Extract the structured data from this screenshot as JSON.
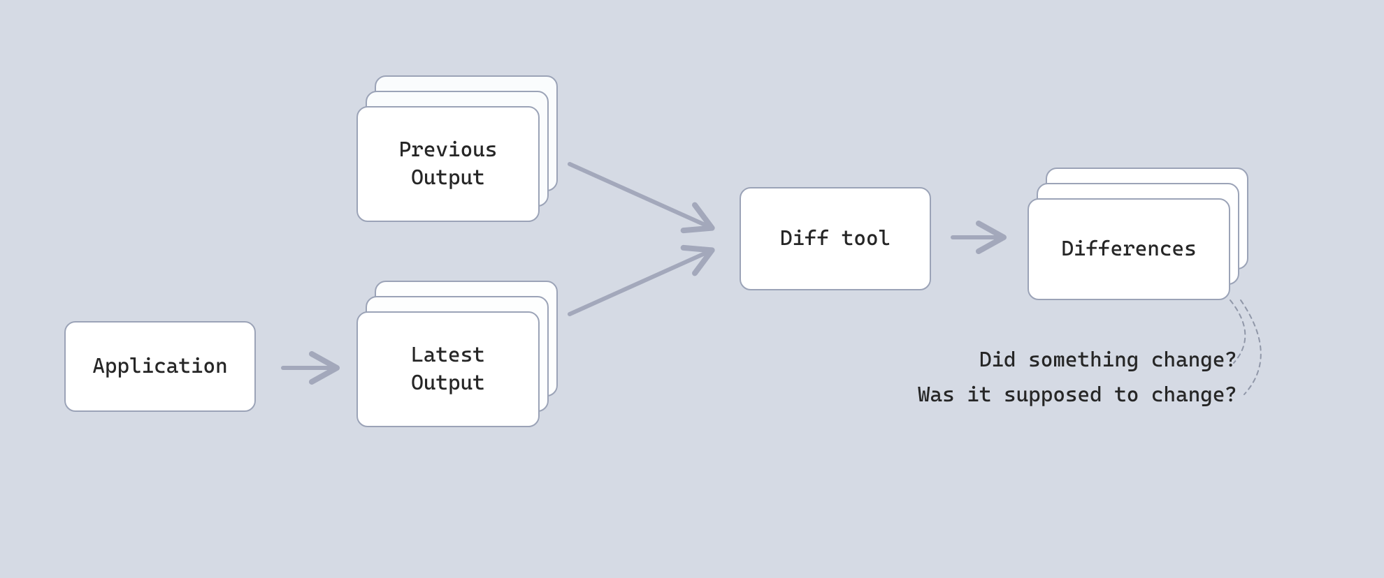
{
  "nodes": {
    "application": {
      "label": "Application"
    },
    "previous_output": {
      "label": "Previous\nOutput"
    },
    "latest_output": {
      "label": "Latest\nOutput"
    },
    "diff_tool": {
      "label": "Diff tool"
    },
    "differences": {
      "label": "Differences"
    }
  },
  "annotations": {
    "q1": "Did something change?",
    "q2": "Was it supposed to change?"
  },
  "colors": {
    "bg": "#d5dae4",
    "node_bg": "#ffffff",
    "border": "#9ba3b7",
    "arrow": "#a3a8bb",
    "dashed": "#9097a8"
  }
}
